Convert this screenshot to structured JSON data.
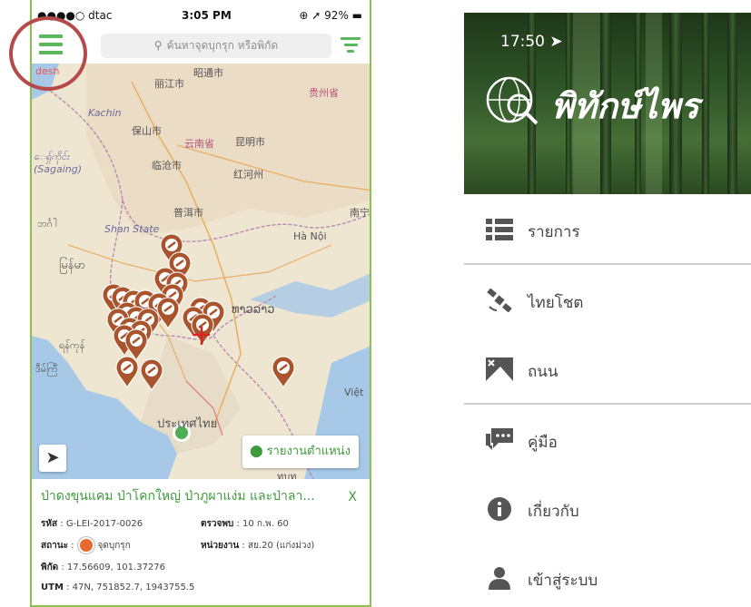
{
  "left": {
    "status": {
      "carrier": "●●●●○ dtac",
      "time": "3:05 PM",
      "battery": "92%"
    },
    "search": {
      "placeholder": "ค้นหาจุดบุกรุก หรือพิกัด"
    },
    "map_labels": {
      "zhaotong": "昭通市",
      "lijiang": "丽江市",
      "kachin": "Kachin",
      "baoshan": "保山市",
      "yunnan": "云南省",
      "kunming": "昆明市",
      "lincang": "临沧市",
      "honghe": "红河州",
      "sagaing": "(Sagaing)",
      "sagaing_my": "ေရှ်ကိုင်း",
      "puer": "普洱市",
      "shan": "Shan State",
      "hanoi": "Hà Nội",
      "myanmar": "မြန်မာ",
      "laos": "ທາວລາວ",
      "burmese2": "ရန်ကုန်",
      "burmese3": "ဒီမ်ကြီ",
      "vietnam": "Việt",
      "thailand": "ประเทศไทย",
      "nan": "南宁",
      "guizhou": "贵州省",
      "xiangan": "ทบุท"
    },
    "report_label": "รายงานตำแหน่ง",
    "info": {
      "title": "ป่าดงขุนแคม ป่าโคกใหญ่ ป่าภูผาแง่ม และป่าลา...",
      "close": "X",
      "code_label": "รหัส",
      "code_value": "G-LEI-2017-0026",
      "found_label": "ตรวจพบ",
      "found_value": "10 ก.พ. 60",
      "status_label": "สถานะ",
      "status_value": "จุดบุกรุก",
      "unit_label": "หน่วยงาน",
      "unit_value": "สย.20 (แก่งม่วง)",
      "coord_label": "พิกัด",
      "coord_value": "17.56609, 101.37276",
      "utm_label": "UTM",
      "utm_value": "47N, 751852.7, 1943755.5"
    }
  },
  "right": {
    "time": "17:50",
    "brand": "พิทักษ์ไพร",
    "menu": [
      {
        "label": "รายการ",
        "icon": "list-icon"
      },
      {
        "label": "ไทยโชต",
        "icon": "satellite-icon"
      },
      {
        "label": "ถนน",
        "icon": "map-icon"
      },
      {
        "label": "คู่มือ",
        "icon": "chat-icon"
      },
      {
        "label": "เกี่ยวกับ",
        "icon": "info-icon"
      },
      {
        "label": "เข้าสู่ระบบ",
        "icon": "user-icon"
      }
    ]
  },
  "colors": {
    "accent": "#3e9a3b",
    "pin": "#a9542c",
    "highlight": "#b54a4a"
  }
}
